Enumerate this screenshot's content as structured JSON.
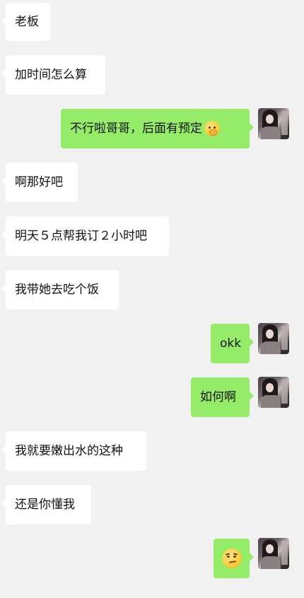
{
  "messages": [
    {
      "side": "in",
      "text": "老板"
    },
    {
      "side": "in",
      "text": "加时间怎么算"
    },
    {
      "side": "out",
      "text": "不行啦哥哥，后面有预定",
      "emoji": "zipper-mouth-emoji"
    },
    {
      "side": "in",
      "text": "啊那好吧"
    },
    {
      "side": "in",
      "text": "明天５点帮我订２小时吧"
    },
    {
      "side": "in",
      "text": "我带她去吃个饭"
    },
    {
      "side": "out",
      "text": "okk"
    },
    {
      "side": "out",
      "text": "如何啊"
    },
    {
      "side": "in",
      "text": "我就要嫩出水的这种"
    },
    {
      "side": "in",
      "text": "还是你懂我"
    },
    {
      "side": "out",
      "text": "",
      "emoji": "smirk-emoji"
    }
  ],
  "colors": {
    "background": "#f1f1f1",
    "incoming_bubble": "#ffffff",
    "outgoing_bubble": "#95ec69",
    "text": "#111111"
  },
  "avatar": "user-avatar-photo"
}
